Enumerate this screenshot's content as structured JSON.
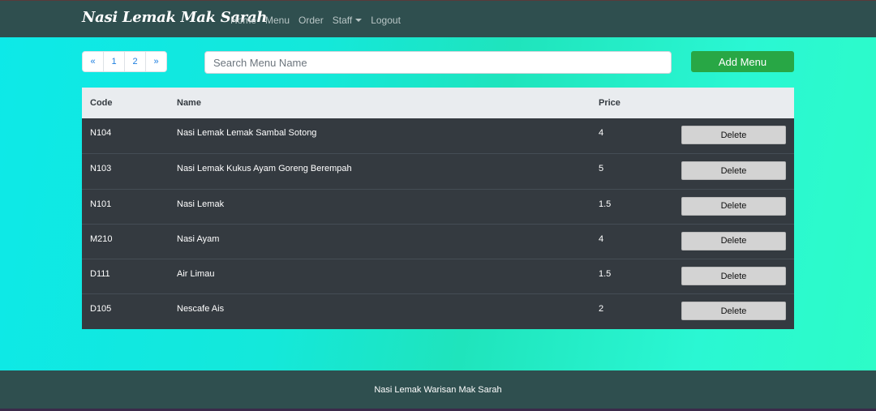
{
  "navbar": {
    "brand": "Nasi Lemak Mak Sarah",
    "links": [
      "Home",
      "Menu",
      "Order",
      "Staff",
      "Logout"
    ]
  },
  "pagination": [
    "«",
    "1",
    "2",
    "»"
  ],
  "search": {
    "placeholder": "Search Menu Name",
    "value": ""
  },
  "add_button": "Add Menu",
  "table": {
    "headers": {
      "code": "Code",
      "name": "Name",
      "price": "Price"
    },
    "delete_label": "Delete",
    "rows": [
      {
        "code": "N104",
        "name": "Nasi Lemak Lemak Sambal Sotong",
        "price": "4"
      },
      {
        "code": "N103",
        "name": "Nasi Lemak Kukus Ayam Goreng Berempah",
        "price": "5"
      },
      {
        "code": "N101",
        "name": "Nasi Lemak",
        "price": "1.5"
      },
      {
        "code": "M210",
        "name": "Nasi Ayam",
        "price": "4"
      },
      {
        "code": "D111",
        "name": "Air Limau",
        "price": "1.5"
      },
      {
        "code": "D105",
        "name": "Nescafe Ais",
        "price": "2"
      }
    ]
  },
  "footer": {
    "text": "Nasi Lemak Warisan Mak Sarah"
  },
  "colors": {
    "navbar_bg": "#2f4f4f",
    "table_bg": "#343a40",
    "add_button_bg": "#28a745",
    "delete_button_bg": "#d3d3d3"
  }
}
